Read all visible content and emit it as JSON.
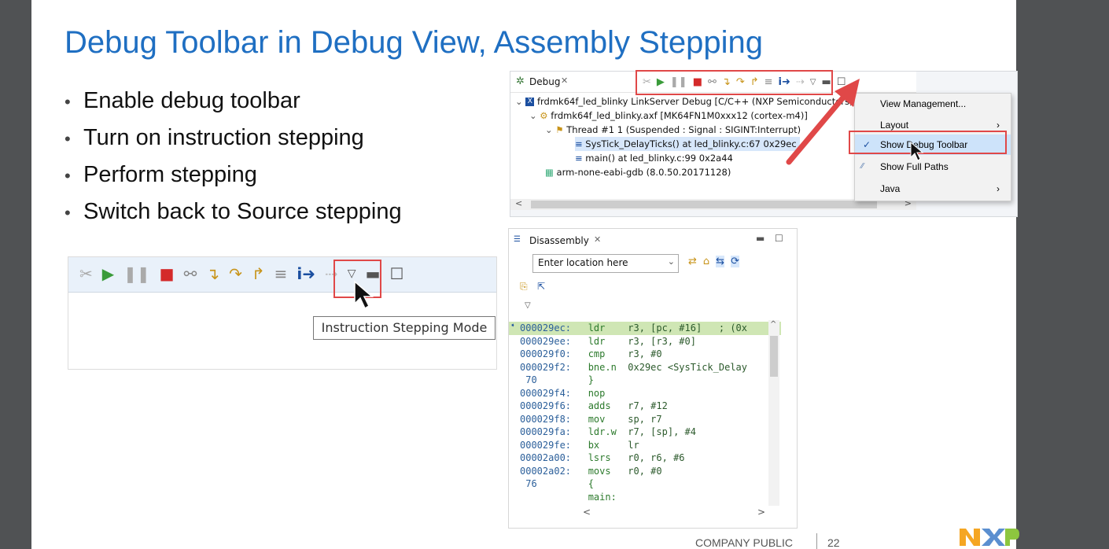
{
  "slide": {
    "title": "Debug Toolbar in Debug View, Assembly Stepping",
    "bullets": [
      "Enable debug toolbar",
      "Turn on instruction stepping",
      "Perform stepping",
      "Switch back to Source stepping"
    ],
    "footer": "COMPANY PUBLIC",
    "page_number": "22",
    "brand": "NXP"
  },
  "debug_view": {
    "tab_label": "Debug",
    "tree": [
      "frdmk64f_led_blinky LinkServer Debug [C/C++ (NXP Semiconductors)]",
      "frdmk64f_led_blinky.axf [MK64FN1M0xxx12 (cortex-m4)]",
      "Thread #1 1 (Suspended : Signal : SIGINT:Interrupt)",
      "SysTick_DelayTicks() at led_blinky.c:67 0x29ec",
      "main() at led_blinky.c:99 0x2a44",
      "arm-none-eabi-gdb (8.0.50.20171128)"
    ],
    "menu": [
      "View Management...",
      "Layout",
      "Show Debug Toolbar",
      "Show Full Paths",
      "Java"
    ]
  },
  "disassembly": {
    "tab_label": "Disassembly",
    "location_placeholder": "Enter location here",
    "lines": [
      {
        "addr": "000029ec:",
        "op": "ldr",
        "args": "r3, [pc, #16]   ; (0x"
      },
      {
        "addr": "000029ee:",
        "op": "ldr",
        "args": "r3, [r3, #0]"
      },
      {
        "addr": "000029f0:",
        "op": "cmp",
        "args": "r3, #0"
      },
      {
        "addr": "000029f2:",
        "op": "bne.n",
        "args": "0x29ec <SysTick_Delay"
      },
      {
        "addr": " 70",
        "op": "}",
        "args": ""
      },
      {
        "addr": "000029f4:",
        "op": "nop",
        "args": ""
      },
      {
        "addr": "000029f6:",
        "op": "adds",
        "args": "r7, #12"
      },
      {
        "addr": "000029f8:",
        "op": "mov",
        "args": "sp, r7"
      },
      {
        "addr": "000029fa:",
        "op": "ldr.w",
        "args": "r7, [sp], #4"
      },
      {
        "addr": "000029fe:",
        "op": "bx",
        "args": "lr"
      },
      {
        "addr": "00002a00:",
        "op": "lsrs",
        "args": "r0, r6, #6"
      },
      {
        "addr": "00002a02:",
        "op": "movs",
        "args": "r0, #0"
      },
      {
        "addr": " 76",
        "op": "{",
        "args": ""
      },
      {
        "addr": "",
        "op": "main:",
        "args": ""
      }
    ]
  },
  "toolbar_zoom": {
    "tooltip": "Instruction Stepping Mode"
  },
  "colors": {
    "title": "#1f6fc2",
    "highlight": "#cfe6b4",
    "redbox": "#e04848",
    "nxp_orange": "#f5a623",
    "nxp_blue": "#1e73c0",
    "nxp_green": "#8dc63f"
  }
}
